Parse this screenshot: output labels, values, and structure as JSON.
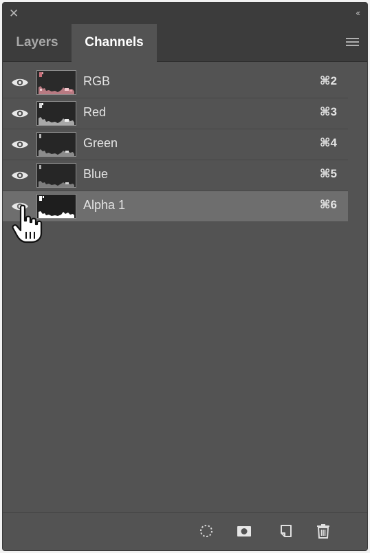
{
  "window": {
    "close_icon": "close-icon",
    "collapse_icon": "collapse-double-chevron-icon"
  },
  "tabs": [
    {
      "label": "Layers",
      "active": false
    },
    {
      "label": "Channels",
      "active": true
    }
  ],
  "panel_menu_icon": "hamburger-menu-icon",
  "channels": [
    {
      "name": "RGB",
      "shortcut": "⌘2",
      "visible": true,
      "selected": false
    },
    {
      "name": "Red",
      "shortcut": "⌘3",
      "visible": true,
      "selected": false
    },
    {
      "name": "Green",
      "shortcut": "⌘4",
      "visible": true,
      "selected": false
    },
    {
      "name": "Blue",
      "shortcut": "⌘5",
      "visible": true,
      "selected": false
    },
    {
      "name": "Alpha 1",
      "shortcut": "⌘6",
      "visible": false,
      "selected": true
    }
  ],
  "footer_buttons": [
    {
      "name": "load-channel-as-selection-icon"
    },
    {
      "name": "save-selection-as-channel-icon"
    },
    {
      "name": "create-new-channel-icon"
    },
    {
      "name": "delete-channel-icon"
    }
  ],
  "colors": {
    "panel_bg": "#535353",
    "header_bg": "#3c3c3c",
    "selected_row": "#6e6e6e",
    "text": "#e4e4e4"
  }
}
